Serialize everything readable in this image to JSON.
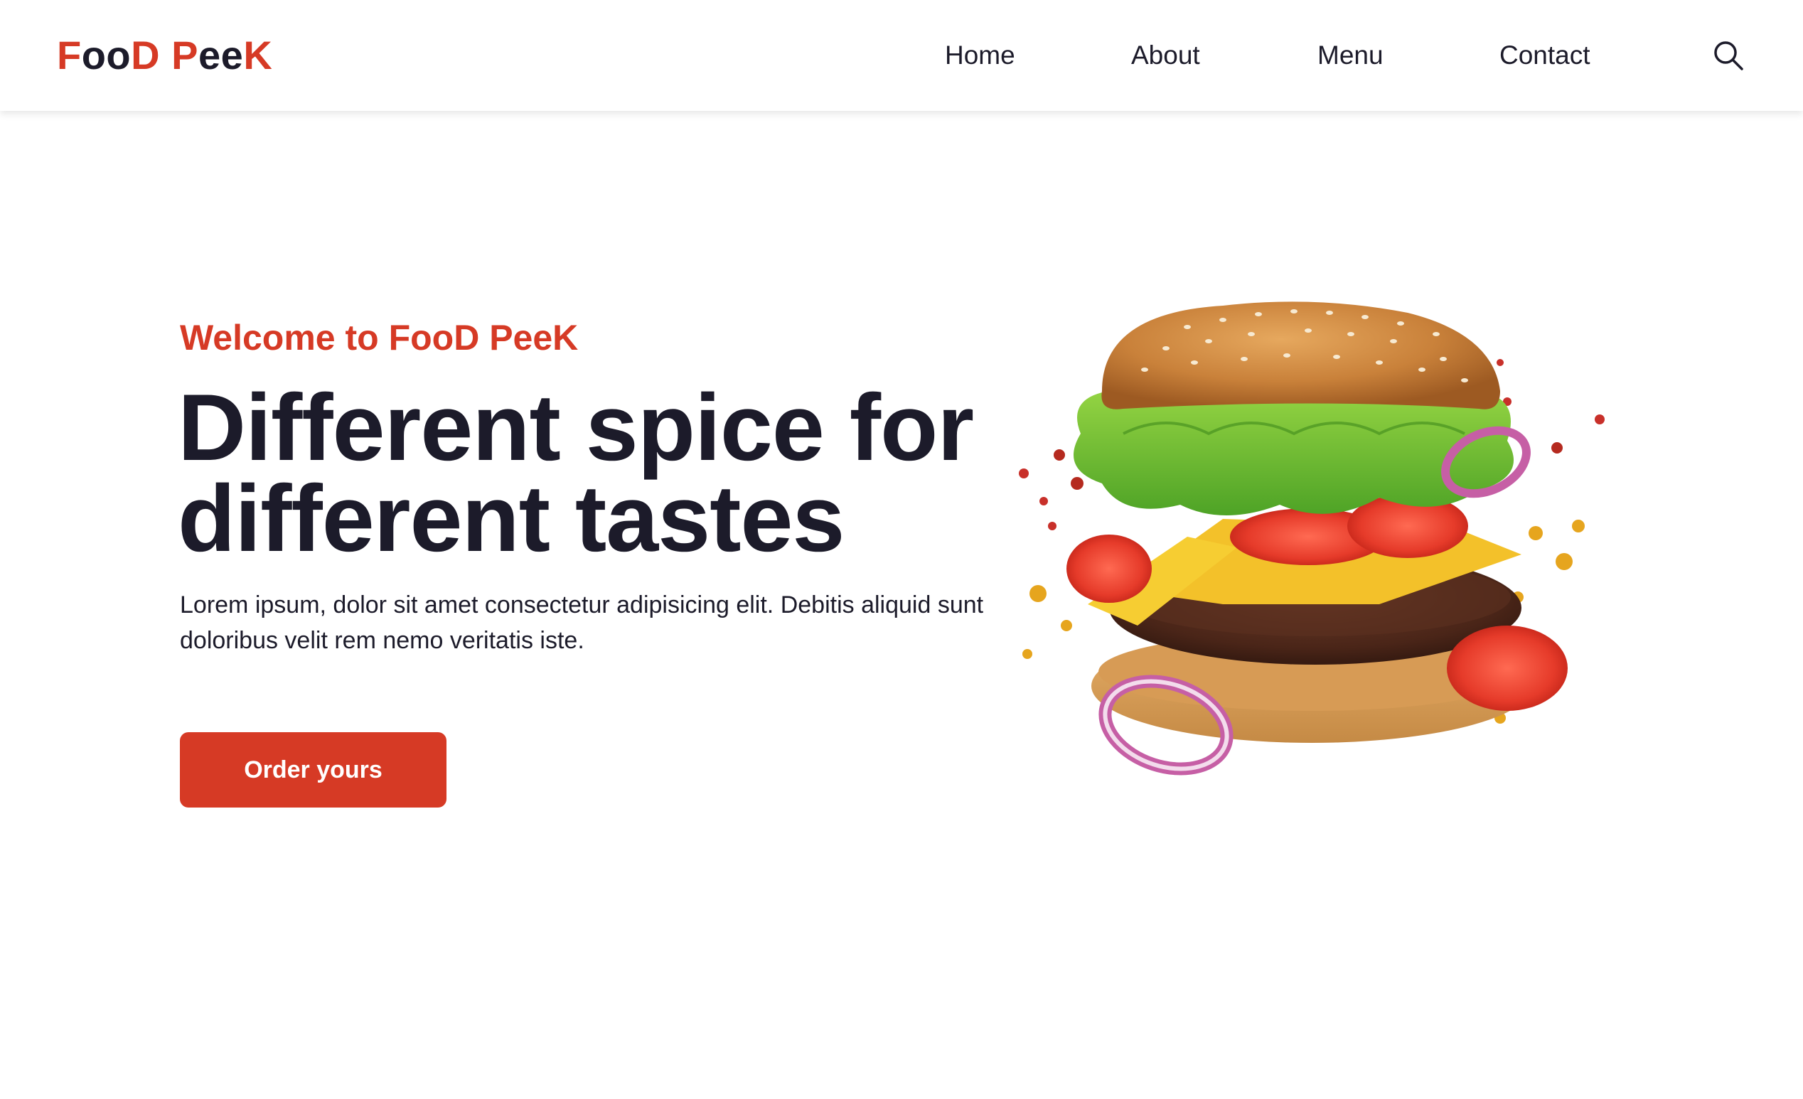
{
  "header": {
    "logo": {
      "part1_red": "F",
      "part1_dark": "oo",
      "part1_red_end": "D",
      "part2_red": "P",
      "part2_dark": "ee",
      "part2_red_end": "K"
    },
    "nav": {
      "home": "Home",
      "about": "About",
      "menu": "Menu",
      "contact": "Contact"
    },
    "search_icon": "search-icon"
  },
  "hero": {
    "welcome": "Welcome to FooD PeeK",
    "headline_line1": "Different spice for",
    "headline_line2": "different tastes",
    "description": "Lorem ipsum, dolor sit amet consectetur adipisicing elit. Debitis aliquid sunt doloribus velit rem nemo veritatis iste.",
    "cta_label": "Order yours",
    "image": "burger-illustration"
  },
  "colors": {
    "brand_red": "#d63a25",
    "text_dark": "#1c1b2a",
    "background": "#ffffff"
  }
}
